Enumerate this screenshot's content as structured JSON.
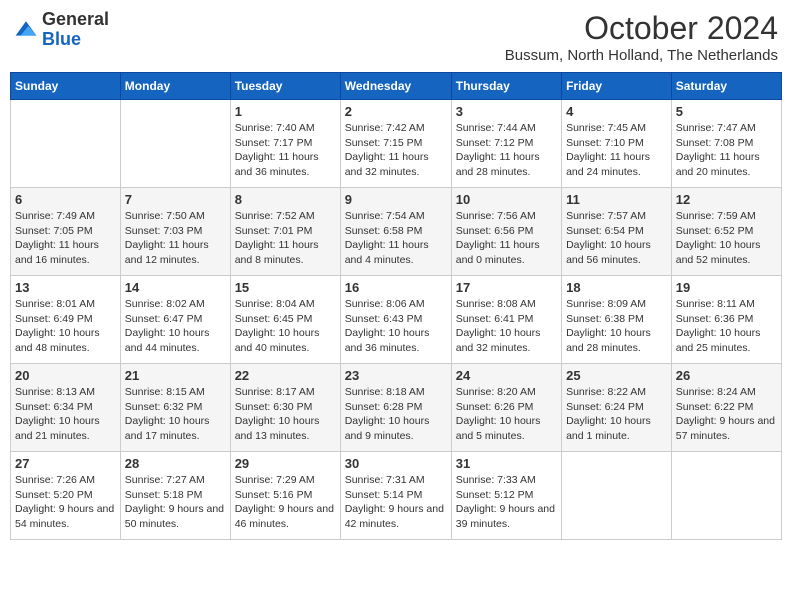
{
  "header": {
    "logo_line1": "General",
    "logo_line2": "Blue",
    "month": "October 2024",
    "location": "Bussum, North Holland, The Netherlands"
  },
  "days_of_week": [
    "Sunday",
    "Monday",
    "Tuesday",
    "Wednesday",
    "Thursday",
    "Friday",
    "Saturday"
  ],
  "weeks": [
    [
      {
        "day": "",
        "sunrise": "",
        "sunset": "",
        "daylight": ""
      },
      {
        "day": "",
        "sunrise": "",
        "sunset": "",
        "daylight": ""
      },
      {
        "day": "1",
        "sunrise": "Sunrise: 7:40 AM",
        "sunset": "Sunset: 7:17 PM",
        "daylight": "Daylight: 11 hours and 36 minutes."
      },
      {
        "day": "2",
        "sunrise": "Sunrise: 7:42 AM",
        "sunset": "Sunset: 7:15 PM",
        "daylight": "Daylight: 11 hours and 32 minutes."
      },
      {
        "day": "3",
        "sunrise": "Sunrise: 7:44 AM",
        "sunset": "Sunset: 7:12 PM",
        "daylight": "Daylight: 11 hours and 28 minutes."
      },
      {
        "day": "4",
        "sunrise": "Sunrise: 7:45 AM",
        "sunset": "Sunset: 7:10 PM",
        "daylight": "Daylight: 11 hours and 24 minutes."
      },
      {
        "day": "5",
        "sunrise": "Sunrise: 7:47 AM",
        "sunset": "Sunset: 7:08 PM",
        "daylight": "Daylight: 11 hours and 20 minutes."
      }
    ],
    [
      {
        "day": "6",
        "sunrise": "Sunrise: 7:49 AM",
        "sunset": "Sunset: 7:05 PM",
        "daylight": "Daylight: 11 hours and 16 minutes."
      },
      {
        "day": "7",
        "sunrise": "Sunrise: 7:50 AM",
        "sunset": "Sunset: 7:03 PM",
        "daylight": "Daylight: 11 hours and 12 minutes."
      },
      {
        "day": "8",
        "sunrise": "Sunrise: 7:52 AM",
        "sunset": "Sunset: 7:01 PM",
        "daylight": "Daylight: 11 hours and 8 minutes."
      },
      {
        "day": "9",
        "sunrise": "Sunrise: 7:54 AM",
        "sunset": "Sunset: 6:58 PM",
        "daylight": "Daylight: 11 hours and 4 minutes."
      },
      {
        "day": "10",
        "sunrise": "Sunrise: 7:56 AM",
        "sunset": "Sunset: 6:56 PM",
        "daylight": "Daylight: 11 hours and 0 minutes."
      },
      {
        "day": "11",
        "sunrise": "Sunrise: 7:57 AM",
        "sunset": "Sunset: 6:54 PM",
        "daylight": "Daylight: 10 hours and 56 minutes."
      },
      {
        "day": "12",
        "sunrise": "Sunrise: 7:59 AM",
        "sunset": "Sunset: 6:52 PM",
        "daylight": "Daylight: 10 hours and 52 minutes."
      }
    ],
    [
      {
        "day": "13",
        "sunrise": "Sunrise: 8:01 AM",
        "sunset": "Sunset: 6:49 PM",
        "daylight": "Daylight: 10 hours and 48 minutes."
      },
      {
        "day": "14",
        "sunrise": "Sunrise: 8:02 AM",
        "sunset": "Sunset: 6:47 PM",
        "daylight": "Daylight: 10 hours and 44 minutes."
      },
      {
        "day": "15",
        "sunrise": "Sunrise: 8:04 AM",
        "sunset": "Sunset: 6:45 PM",
        "daylight": "Daylight: 10 hours and 40 minutes."
      },
      {
        "day": "16",
        "sunrise": "Sunrise: 8:06 AM",
        "sunset": "Sunset: 6:43 PM",
        "daylight": "Daylight: 10 hours and 36 minutes."
      },
      {
        "day": "17",
        "sunrise": "Sunrise: 8:08 AM",
        "sunset": "Sunset: 6:41 PM",
        "daylight": "Daylight: 10 hours and 32 minutes."
      },
      {
        "day": "18",
        "sunrise": "Sunrise: 8:09 AM",
        "sunset": "Sunset: 6:38 PM",
        "daylight": "Daylight: 10 hours and 28 minutes."
      },
      {
        "day": "19",
        "sunrise": "Sunrise: 8:11 AM",
        "sunset": "Sunset: 6:36 PM",
        "daylight": "Daylight: 10 hours and 25 minutes."
      }
    ],
    [
      {
        "day": "20",
        "sunrise": "Sunrise: 8:13 AM",
        "sunset": "Sunset: 6:34 PM",
        "daylight": "Daylight: 10 hours and 21 minutes."
      },
      {
        "day": "21",
        "sunrise": "Sunrise: 8:15 AM",
        "sunset": "Sunset: 6:32 PM",
        "daylight": "Daylight: 10 hours and 17 minutes."
      },
      {
        "day": "22",
        "sunrise": "Sunrise: 8:17 AM",
        "sunset": "Sunset: 6:30 PM",
        "daylight": "Daylight: 10 hours and 13 minutes."
      },
      {
        "day": "23",
        "sunrise": "Sunrise: 8:18 AM",
        "sunset": "Sunset: 6:28 PM",
        "daylight": "Daylight: 10 hours and 9 minutes."
      },
      {
        "day": "24",
        "sunrise": "Sunrise: 8:20 AM",
        "sunset": "Sunset: 6:26 PM",
        "daylight": "Daylight: 10 hours and 5 minutes."
      },
      {
        "day": "25",
        "sunrise": "Sunrise: 8:22 AM",
        "sunset": "Sunset: 6:24 PM",
        "daylight": "Daylight: 10 hours and 1 minute."
      },
      {
        "day": "26",
        "sunrise": "Sunrise: 8:24 AM",
        "sunset": "Sunset: 6:22 PM",
        "daylight": "Daylight: 9 hours and 57 minutes."
      }
    ],
    [
      {
        "day": "27",
        "sunrise": "Sunrise: 7:26 AM",
        "sunset": "Sunset: 5:20 PM",
        "daylight": "Daylight: 9 hours and 54 minutes."
      },
      {
        "day": "28",
        "sunrise": "Sunrise: 7:27 AM",
        "sunset": "Sunset: 5:18 PM",
        "daylight": "Daylight: 9 hours and 50 minutes."
      },
      {
        "day": "29",
        "sunrise": "Sunrise: 7:29 AM",
        "sunset": "Sunset: 5:16 PM",
        "daylight": "Daylight: 9 hours and 46 minutes."
      },
      {
        "day": "30",
        "sunrise": "Sunrise: 7:31 AM",
        "sunset": "Sunset: 5:14 PM",
        "daylight": "Daylight: 9 hours and 42 minutes."
      },
      {
        "day": "31",
        "sunrise": "Sunrise: 7:33 AM",
        "sunset": "Sunset: 5:12 PM",
        "daylight": "Daylight: 9 hours and 39 minutes."
      },
      {
        "day": "",
        "sunrise": "",
        "sunset": "",
        "daylight": ""
      },
      {
        "day": "",
        "sunrise": "",
        "sunset": "",
        "daylight": ""
      }
    ]
  ]
}
